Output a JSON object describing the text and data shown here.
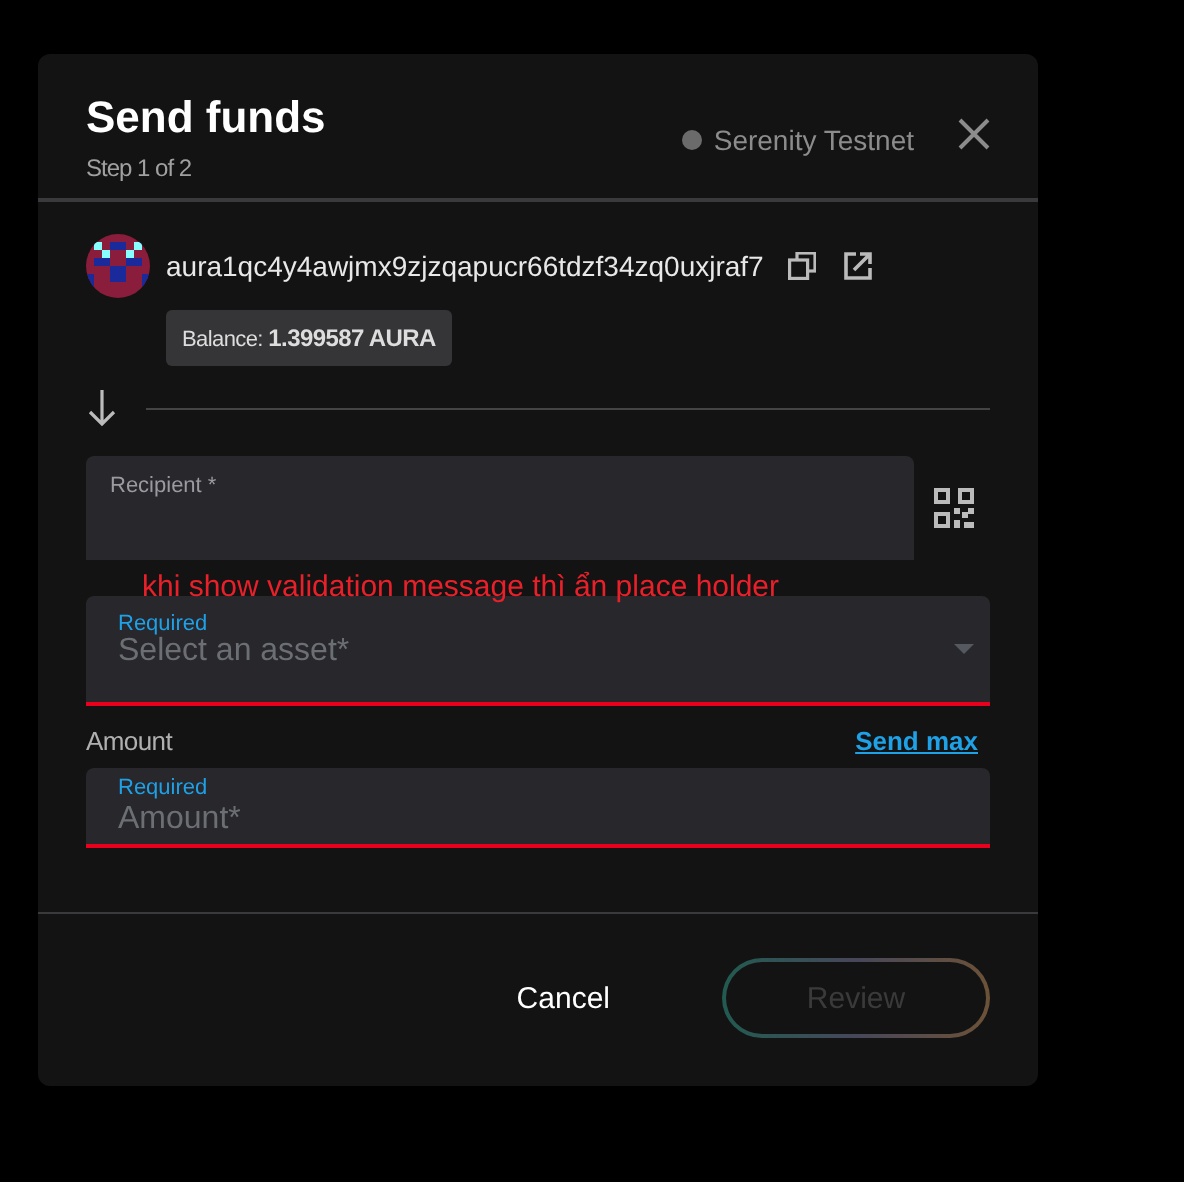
{
  "dialog": {
    "title": "Send funds",
    "step": "Step 1 of 2",
    "network": "Serenity Testnet"
  },
  "account": {
    "address": "aura1qc4y4awjmx9zjzqapucr66tdzf34zq0uxjraf7",
    "balance_label": "Balance:",
    "balance_value": "1.399587 AURA"
  },
  "recipient": {
    "label": "Recipient *"
  },
  "annotation": "khi show validation message thì ẩn place holder",
  "asset": {
    "helper": "Required",
    "placeholder": "Select an asset*",
    "error": true
  },
  "amount": {
    "label": "Amount",
    "send_max": "Send max",
    "helper": "Required",
    "placeholder": "Amount*",
    "error": true
  },
  "buttons": [
    {
      "label": "Cancel",
      "kind": "text",
      "disabled": false
    },
    {
      "label": "Review",
      "kind": "outline",
      "disabled": true
    }
  ]
}
